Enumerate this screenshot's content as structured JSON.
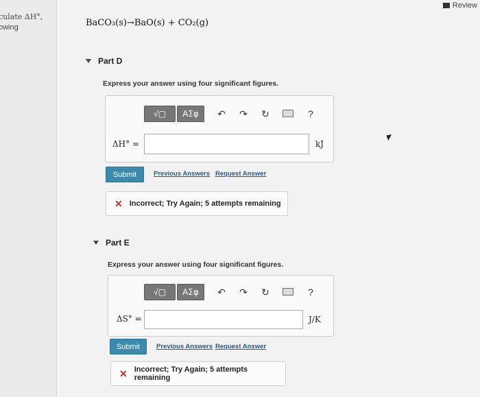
{
  "header": {
    "review_label": "Review"
  },
  "left_panel": {
    "line1": "culate ΔH°,",
    "line2": "owing"
  },
  "equation": "BaCO₃(s)→BaO(s) + CO₂(g)",
  "toolbar": {
    "template_label": "√▢",
    "greek_label": "ΑΣφ",
    "undo": "↶",
    "redo": "↷",
    "reset": "↻",
    "help": "?"
  },
  "part_d": {
    "title": "Part D",
    "instruction": "Express your answer using four significant figures.",
    "var_label": "ΔH° =",
    "input_value": "",
    "unit": "kJ",
    "submit_label": "Submit",
    "previous_answers": "Previous Answers",
    "request_answer": "Request Answer",
    "feedback": "Incorrect; Try Again; 5 attempts remaining"
  },
  "part_e": {
    "title": "Part E",
    "instruction": "Express your answer using four significant figures.",
    "var_label": "ΔS° =",
    "input_value": "",
    "unit": "J/K",
    "submit_label": "Submit",
    "previous_answers": "Previous Answers",
    "request_answer": "Request Answer",
    "feedback": "Incorrect; Try Again; 5 attempts remaining"
  }
}
